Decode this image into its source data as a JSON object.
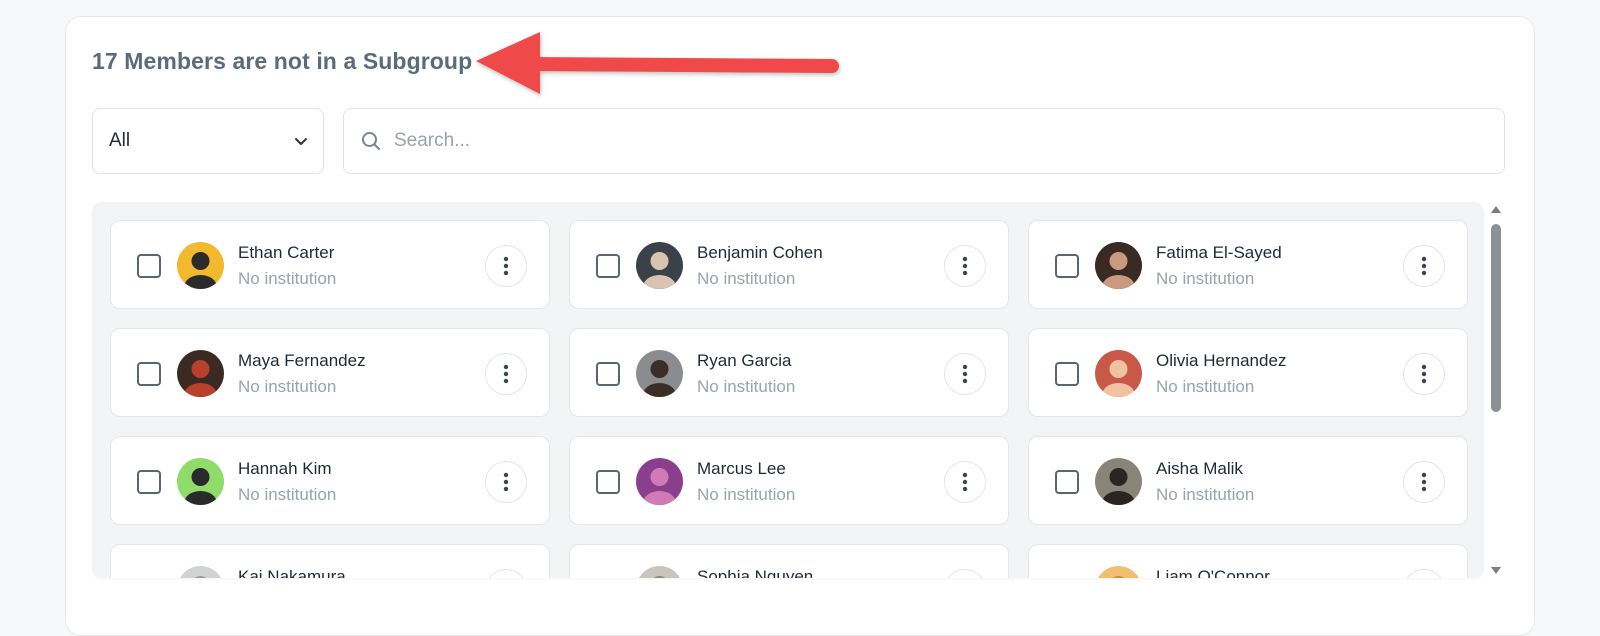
{
  "header": {
    "title": "17 Members are not in a Subgroup"
  },
  "filter": {
    "selected": "All",
    "icon": "chevron-down-icon"
  },
  "search": {
    "placeholder": "Search...",
    "value": "",
    "icon": "search-icon"
  },
  "annotation": {
    "arrow_color": "#f04848"
  },
  "members": [
    {
      "name": "Ethan Carter",
      "institution": "No institution",
      "avatar_bg": "#f2b82e",
      "avatar_fg": "#2b2b2b"
    },
    {
      "name": "Benjamin Cohen",
      "institution": "No institution",
      "avatar_bg": "#3b4148",
      "avatar_fg": "#d8c4b0"
    },
    {
      "name": "Fatima El-Sayed",
      "institution": "No institution",
      "avatar_bg": "#3a2a24",
      "avatar_fg": "#c99a7e"
    },
    {
      "name": "Maya Fernandez",
      "institution": "No institution",
      "avatar_bg": "#3b2a22",
      "avatar_fg": "#b8402c"
    },
    {
      "name": "Ryan Garcia",
      "institution": "No institution",
      "avatar_bg": "#8a8c90",
      "avatar_fg": "#3a2e26"
    },
    {
      "name": "Olivia Hernandez",
      "institution": "No institution",
      "avatar_bg": "#c85848",
      "avatar_fg": "#f0c2a0"
    },
    {
      "name": "Hannah Kim",
      "institution": "No institution",
      "avatar_bg": "#8fdc6a",
      "avatar_fg": "#2a2a2a"
    },
    {
      "name": "Marcus Lee",
      "institution": "No institution",
      "avatar_bg": "#8a3f8c",
      "avatar_fg": "#d07ab8"
    },
    {
      "name": "Aisha Malik",
      "institution": "No institution",
      "avatar_bg": "#8a8478",
      "avatar_fg": "#2a2522"
    },
    {
      "name": "Kai Nakamura",
      "institution": "",
      "avatar_bg": "#d0d2d4",
      "avatar_fg": "#9a9ca0"
    },
    {
      "name": "Sophia Nguyen",
      "institution": "",
      "avatar_bg": "#c8c4be",
      "avatar_fg": "#8a8680"
    },
    {
      "name": "Liam O'Connor",
      "institution": "",
      "avatar_bg": "#f0c070",
      "avatar_fg": "#c89040"
    }
  ],
  "more_icon": "more-vertical-icon"
}
